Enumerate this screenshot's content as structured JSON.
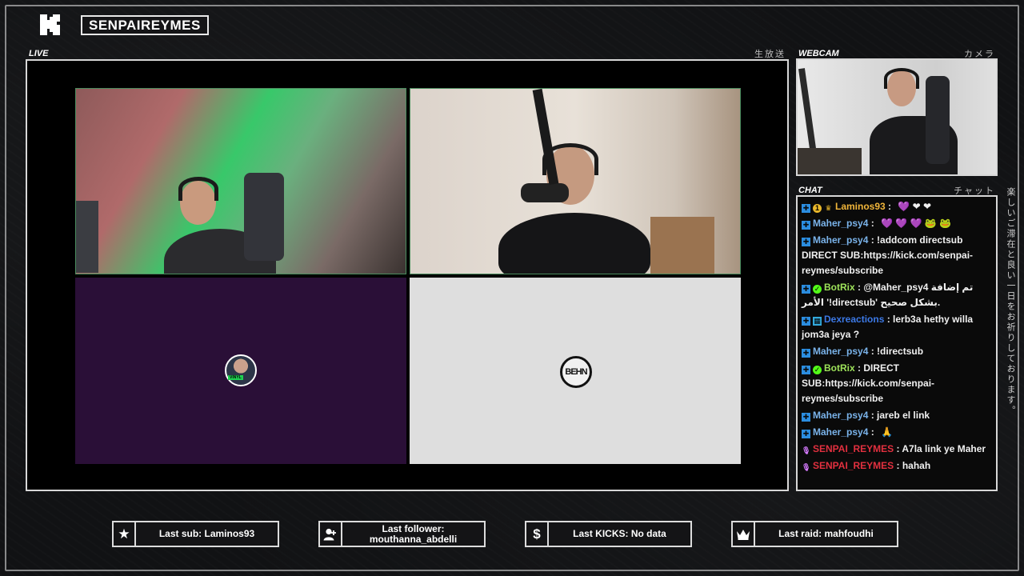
{
  "channel": {
    "name": "SENPAIREYMES",
    "logo_letter": "K"
  },
  "live": {
    "label": "LIVE",
    "jp": "生放送"
  },
  "webcam": {
    "label": "WEBCAM",
    "jp": "カメラ"
  },
  "chat": {
    "label": "CHAT",
    "jp": "チャット",
    "messages": [
      {
        "user": "Laminos93",
        "text": "",
        "emotes": "💜 ❤ ❤"
      },
      {
        "user": "Maher_psy4",
        "text": "",
        "emotes": "💜 💜 💜 🐸 🐸"
      },
      {
        "user": "Maher_psy4",
        "text": "!addcom directsub DIRECT SUB:https://kick.com/senpai-reymes/subscribe"
      },
      {
        "user": "BotRix",
        "text": "@Maher_psy4 تم إضافة الأمر '!directsub' بشكل صحيح."
      },
      {
        "user": "Dexreactions",
        "text": "lerb3a hethy willa jom3a jeya ?"
      },
      {
        "user": "Maher_psy4",
        "text": "!directsub"
      },
      {
        "user": "BotRix",
        "text": "DIRECT SUB:https://kick.com/senpai-reymes/subscribe"
      },
      {
        "user": "Maher_psy4",
        "text": "jareb el link"
      },
      {
        "user": "Maher_psy4",
        "text": "",
        "emotes": "🙏"
      },
      {
        "user": "SENPAI_REYMES",
        "text": "A7la link ye Maher"
      },
      {
        "user": "SENPAI_REYMES",
        "text": "hahah"
      }
    ],
    "separator": " : "
  },
  "side_text": "楽しいご滞在と良い一日をお祈りしております。",
  "tiles": {
    "avatar_badge": "VINYL",
    "team_logo": "BEHN"
  },
  "stats": {
    "last_sub": "Last sub: Laminos93",
    "last_follower": "Last follower: mouthanna_abdelli",
    "last_kicks": "Last KICKS: No data",
    "last_raid": "Last raid: mahfoudhi"
  },
  "icons": {
    "sub": "star-icon",
    "follower": "user-plus-icon",
    "kicks": "dollar-icon",
    "raid": "crown-icon"
  },
  "colors": {
    "kick_green": "#53fc18",
    "frame": "#d7d7d7",
    "senpai_red": "#e2303f"
  }
}
